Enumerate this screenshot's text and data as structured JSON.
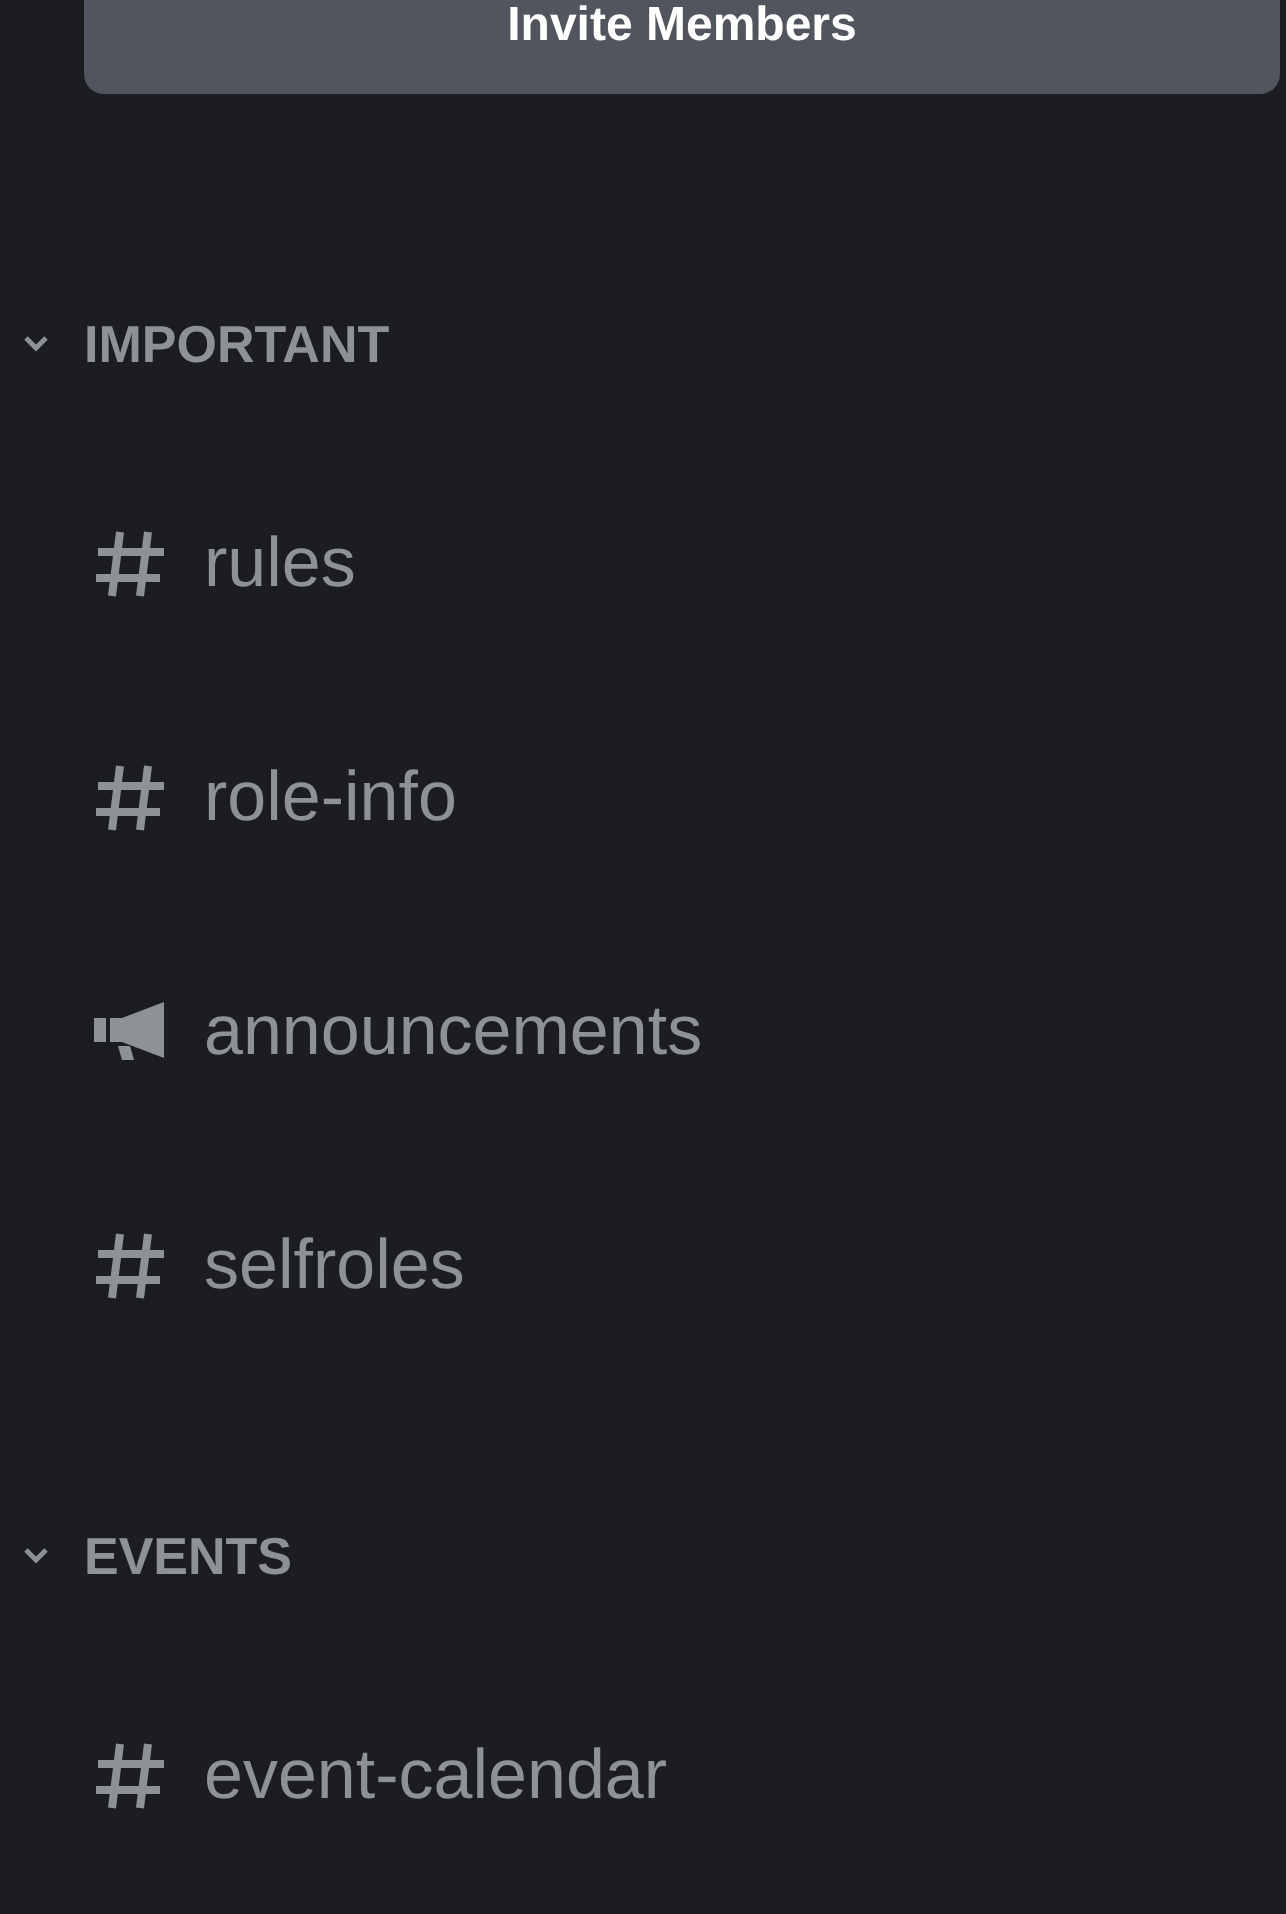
{
  "invite_button": {
    "label": "Invite Members"
  },
  "categories": [
    {
      "name": "IMPORTANT",
      "expanded": true,
      "channels": [
        {
          "kind": "text",
          "name": "rules"
        },
        {
          "kind": "text",
          "name": "role-info"
        },
        {
          "kind": "announcement",
          "name": "announcements"
        },
        {
          "kind": "text",
          "name": "selfroles"
        }
      ]
    },
    {
      "name": "EVENTS",
      "expanded": true,
      "channels": [
        {
          "kind": "text",
          "name": "event-calendar"
        }
      ]
    }
  ]
}
